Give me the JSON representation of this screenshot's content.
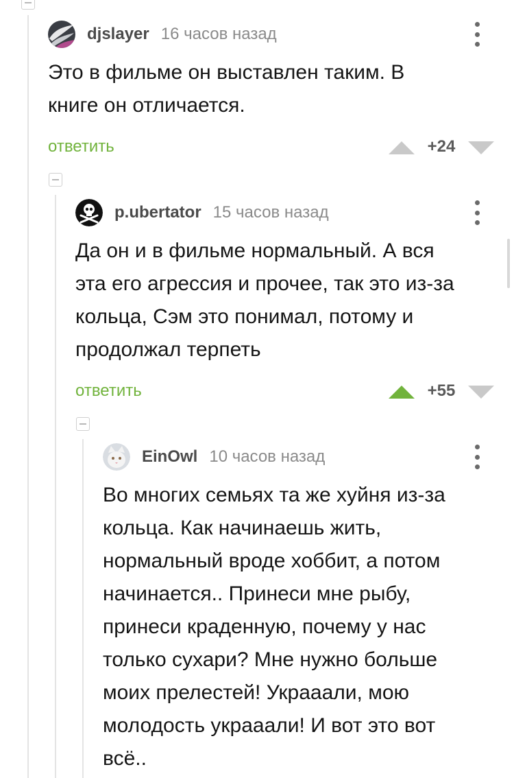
{
  "comments": [
    {
      "username": "djslayer",
      "time": "16 часов назад",
      "text_lines": [
        "Это в фильме он выставлен таким. В",
        "книге он отличается."
      ],
      "reply_label": "ответить",
      "rating": "+24",
      "upvoted": false
    },
    {
      "username": "p.ubertator",
      "time": "15 часов назад",
      "text_lines": [
        "Да он и в фильме нормальный. А вся",
        "эта его агрессия и прочее, так это из-за",
        "кольца, Сэм это понимал, потому и",
        "продолжал терпеть"
      ],
      "reply_label": "ответить",
      "rating": "+55",
      "upvoted": true
    },
    {
      "username": "EinOwl",
      "time": "10 часов назад",
      "text_lines": [
        "Во многих семьях та же хуйня из-за",
        "кольца. Как начинаешь жить,",
        "нормальный вроде хоббит, а потом",
        "начинается.. Принеси мне рыбу,",
        "принеси краденную, почему у нас",
        "только сухари? Мне нужно больше",
        "моих прелестей! Украаали, мою",
        "молодость украаали! И вот это вот",
        "всё.."
      ]
    }
  ],
  "colors": {
    "accent_green": "#71b33c",
    "vote_inactive": "#c9c9c9",
    "thread_line": "#e4e4e4"
  },
  "icons": {
    "upvote": "triangle-up-icon",
    "downvote": "triangle-down-icon",
    "menu": "vertical-dots-icon",
    "collapse": "minus-box-icon"
  }
}
